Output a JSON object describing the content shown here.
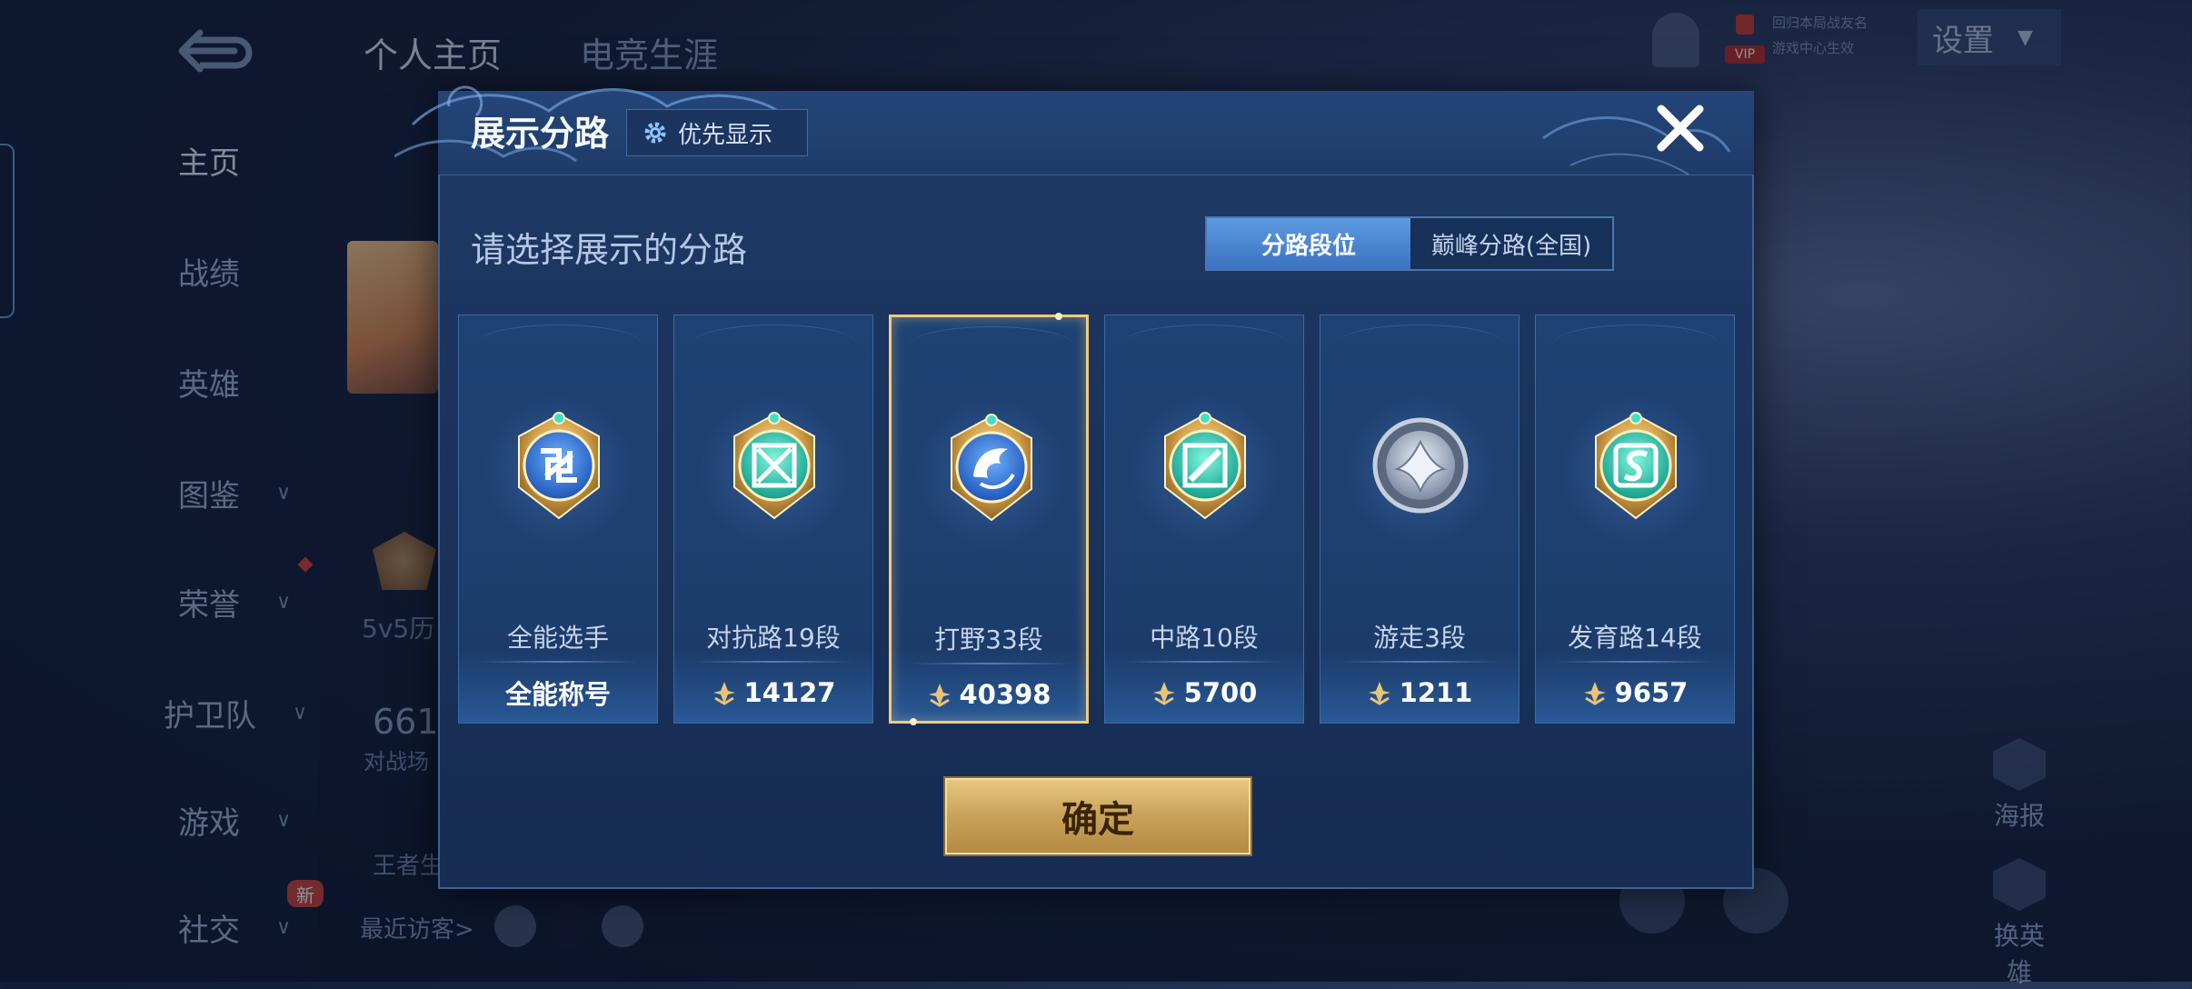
{
  "background": {
    "tabs": [
      "个人主页",
      "电竞生涯"
    ],
    "sidebar": [
      {
        "label": "主页",
        "chevron": false,
        "active": true
      },
      {
        "label": "战绩",
        "chevron": false
      },
      {
        "label": "英雄",
        "chevron": false
      },
      {
        "label": "图鉴",
        "chevron": true
      },
      {
        "label": "荣誉",
        "chevron": true
      },
      {
        "label": "护卫队",
        "chevron": true
      },
      {
        "label": "游戏",
        "chevron": true
      },
      {
        "label": "社交",
        "chevron": true
      }
    ],
    "new_badge": "新",
    "settings_label": "设置",
    "vip_label": "VIP",
    "top_small_1": "回归本局战友名",
    "top_small_2": "游戏中心生效",
    "stat_number": "661",
    "stat_label": "对战场",
    "history_label": "5v5历",
    "king_label": "王者生",
    "recent_visitors": "最近访客>",
    "tool_poster": "海报",
    "tool_switch_hero": "换英雄"
  },
  "modal": {
    "title": "展示分路",
    "priority_label": "优先显示",
    "subtitle": "请选择展示的分路",
    "segment": {
      "options": [
        "分路段位",
        "巅峰分路(全国)"
      ],
      "active_index": 0
    },
    "cards": [
      {
        "label": "全能选手",
        "value": "全能称号",
        "has_points_icon": false,
        "badge": "allround",
        "selected": false
      },
      {
        "label": "对抗路19段",
        "value": "14127",
        "has_points_icon": true,
        "badge": "clash",
        "selected": false
      },
      {
        "label": "打野33段",
        "value": "40398",
        "has_points_icon": true,
        "badge": "jungle",
        "selected": true
      },
      {
        "label": "中路10段",
        "value": "5700",
        "has_points_icon": true,
        "badge": "mid",
        "selected": false
      },
      {
        "label": "游走3段",
        "value": "1211",
        "has_points_icon": true,
        "badge": "roam",
        "selected": false
      },
      {
        "label": "发育路14段",
        "value": "9657",
        "has_points_icon": true,
        "badge": "farm",
        "selected": false
      }
    ],
    "confirm_label": "确定"
  },
  "colors": {
    "gold": "#e6c77f",
    "selected_border": "#f0cb7c",
    "teal_badge": "#2fd1b8",
    "blue_badge": "#2f6fd4",
    "silver_badge": "#aeb9cc"
  }
}
